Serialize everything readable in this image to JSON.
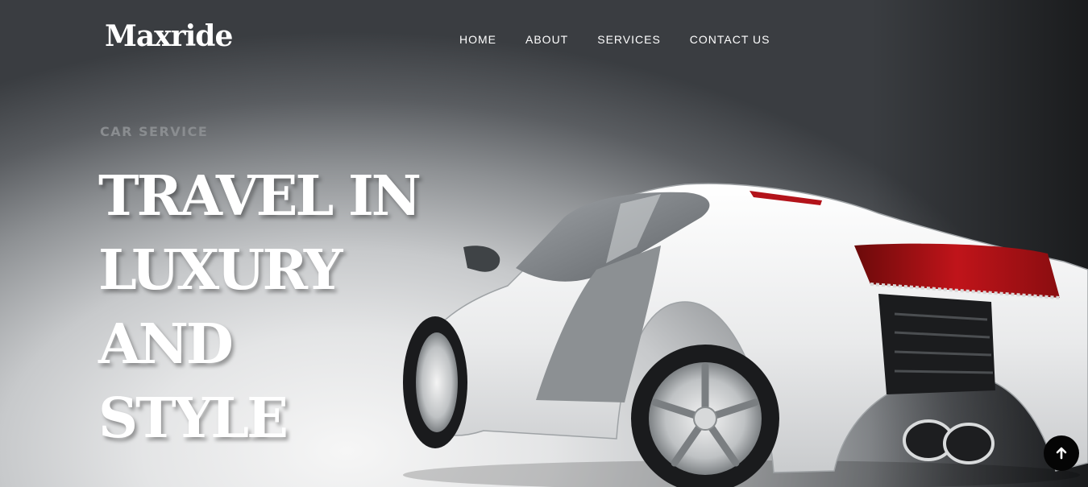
{
  "brand": {
    "logo_text": "Maxride"
  },
  "nav": {
    "items": [
      {
        "label": "HOME"
      },
      {
        "label": "ABOUT"
      },
      {
        "label": "SERVICES"
      },
      {
        "label": "CONTACT US"
      }
    ]
  },
  "hero": {
    "kicker": "CAR SERVICE",
    "headline_lines": [
      "TRAVEL IN",
      "LUXURY AND",
      "STYLE"
    ]
  },
  "icons": {
    "scroll_top": "arrow-up-icon"
  },
  "colors": {
    "text_primary": "#ffffff",
    "kicker": "#8a8d90",
    "scroll_button_bg": "#050505"
  }
}
